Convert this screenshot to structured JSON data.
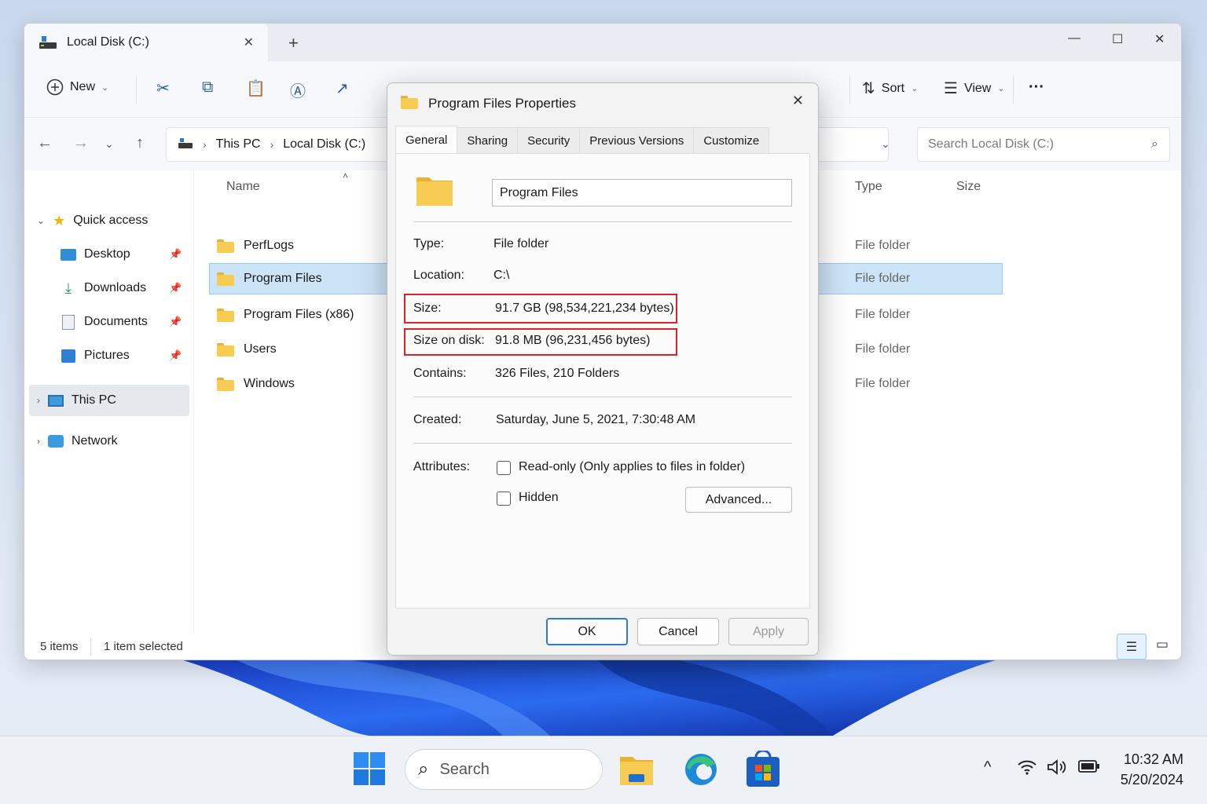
{
  "explorer": {
    "tab_title": "Local Disk (C:)",
    "tab_close": "✕",
    "new_tab": "+",
    "window_controls": {
      "minimize": "—",
      "maximize": "☐",
      "close": "✕"
    },
    "command_bar": {
      "new_label": "New",
      "sort_label": "Sort",
      "view_label": "View",
      "more": "···"
    },
    "breadcrumb": [
      "This PC",
      "Local Disk (C:)"
    ],
    "search_placeholder": "Search Local Disk (C:)",
    "nav": {
      "quick_access": "Quick access",
      "items": [
        {
          "label": "Desktop",
          "icon": "desktop-icon"
        },
        {
          "label": "Downloads",
          "icon": "downloads-icon"
        },
        {
          "label": "Documents",
          "icon": "documents-icon"
        },
        {
          "label": "Pictures",
          "icon": "pictures-icon"
        }
      ],
      "this_pc": "This PC",
      "network": "Network"
    },
    "columns": {
      "name": "Name",
      "type": "Type",
      "size": "Size"
    },
    "files": [
      {
        "name": "PerfLogs",
        "type": "File folder"
      },
      {
        "name": "Program Files",
        "type": "File folder"
      },
      {
        "name": "Program Files (x86)",
        "type": "File folder"
      },
      {
        "name": "Users",
        "type": "File folder"
      },
      {
        "name": "Windows",
        "type": "File folder"
      }
    ],
    "status": {
      "count": "5 items",
      "selection": "1 item selected"
    }
  },
  "dialog": {
    "title": "Program Files Properties",
    "tabs": [
      "General",
      "Sharing",
      "Security",
      "Previous Versions",
      "Customize"
    ],
    "name_value": "Program Files",
    "type_label": "Type:",
    "type_value": "File folder",
    "location_label": "Location:",
    "location_value": "C:\\",
    "size_label": "Size:",
    "size_value": "91.7 GB (98,534,221,234 bytes)",
    "size_on_disk_label": "Size on disk:",
    "size_on_disk_value": "91.8 MB (96,231,456 bytes)",
    "contains_label": "Contains:",
    "contains_value": "326 Files, 210 Folders",
    "created_label": "Created:",
    "created_value": "Saturday, June 5, 2021, 7:30:48 AM",
    "attributes_label": "Attributes:",
    "readonly_label": "Read-only (Only applies to files in folder)",
    "hidden_label": "Hidden",
    "advanced_label": "Advanced...",
    "ok_label": "OK",
    "cancel_label": "Cancel",
    "apply_label": "Apply",
    "highlight_color": "#d7262a"
  },
  "taskbar": {
    "search_label": "Search",
    "time": "10:32 AM",
    "date": "5/20/2024"
  }
}
